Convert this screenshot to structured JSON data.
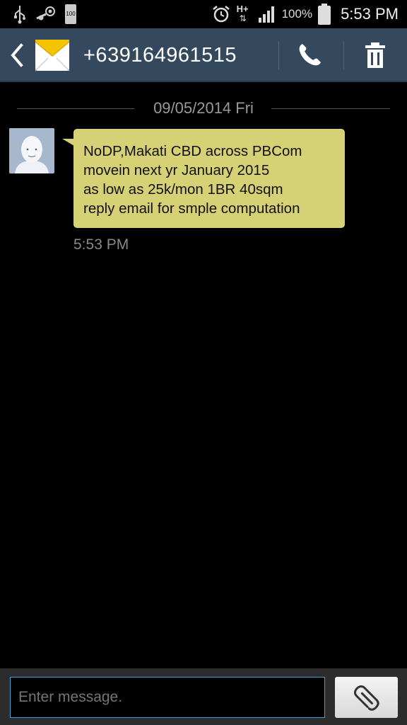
{
  "status_bar": {
    "icons": [
      "usb-icon",
      "steam-icon",
      "battery-saver-icon",
      "alarm-icon",
      "hplus-data-icon",
      "signal-icon",
      "battery-icon"
    ],
    "battery_saver_label": "100",
    "network_label": "H+",
    "battery_percent": "100%",
    "time": "5:53 PM"
  },
  "header": {
    "contact": "+639164961515",
    "back_icon": "back-arrow-icon",
    "avatar_icon": "envelope-icon",
    "call_icon": "phone-icon",
    "delete_icon": "trash-icon"
  },
  "conversation": {
    "date_separator": "09/05/2014 Fri",
    "messages": [
      {
        "lines": [
          "NoDP,Makati CBD across PBCom",
          "movein next yr January 2015",
          "as low as 25k/mon 1BR 40sqm",
          "reply email for smple computation"
        ],
        "time": "5:53 PM"
      }
    ]
  },
  "compose": {
    "placeholder": "Enter message.",
    "attach_icon": "paperclip-icon"
  },
  "colors": {
    "header_bg": "#34495e",
    "bubble_bg": "#d6d175",
    "input_border": "#3aa3d6"
  }
}
